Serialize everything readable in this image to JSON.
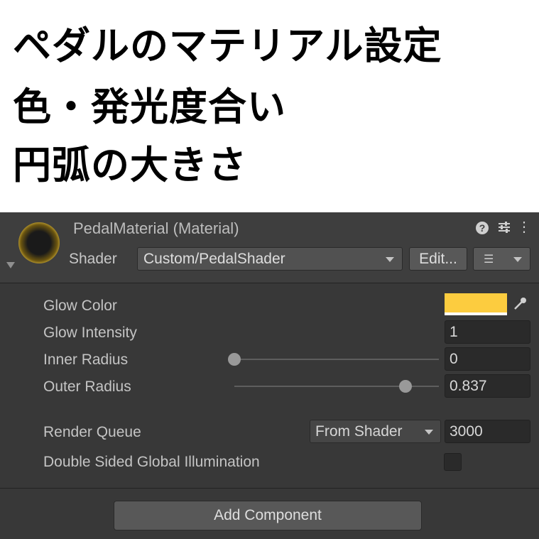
{
  "caption": {
    "line1": "ペダルのマテリアル設定",
    "line2": "色・発光度合い",
    "line3": "円弧の大きさ"
  },
  "header": {
    "title": "PedalMaterial (Material)",
    "shader_label": "Shader",
    "shader_value": "Custom/PedalShader",
    "edit_label": "Edit...",
    "icons": [
      "help-icon",
      "preset-icon",
      "menu-icon",
      "list-icon",
      "chevron-down-icon"
    ]
  },
  "properties": {
    "glow_color": {
      "label": "Glow Color",
      "value": "#fccc3f"
    },
    "glow_intensity": {
      "label": "Glow Intensity",
      "value": "1"
    },
    "inner_radius": {
      "label": "Inner Radius",
      "value": "0",
      "slider_fraction": 0.0
    },
    "outer_radius": {
      "label": "Outer Radius",
      "value": "0.837",
      "slider_fraction": 0.837
    }
  },
  "render_queue": {
    "label": "Render Queue",
    "mode": "From Shader",
    "value": "3000"
  },
  "double_sided_gi": {
    "label": "Double Sided Global Illumination",
    "checked": false
  },
  "add_component_label": "Add Component",
  "colors": {
    "panel_bg": "#383838",
    "header_bg": "#3e3e3e",
    "glow_color": "#fccc3f"
  }
}
